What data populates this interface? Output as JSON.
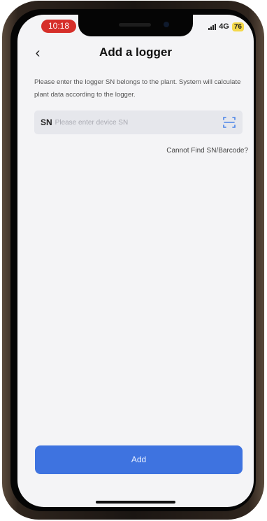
{
  "status_bar": {
    "time": "10:18",
    "network": "4G",
    "battery": "76"
  },
  "header": {
    "back_symbol": "‹",
    "title": "Add a logger"
  },
  "description": "Please enter the logger SN belongs to the plant. System will calculate plant data according to the logger.",
  "sn_field": {
    "label": "SN",
    "value": "",
    "placeholder": "Please enter device SN"
  },
  "cannot_find_link": "Cannot Find SN/Barcode?",
  "add_button": "Add",
  "colors": {
    "accent": "#3e73e0",
    "time_pill": "#d62f2a",
    "battery": "#f4d84a",
    "screen_bg": "#f4f4f6",
    "field_bg": "#e6e7ec"
  },
  "icons": {
    "back": "chevron-left-icon",
    "scan": "scan-barcode-icon"
  }
}
